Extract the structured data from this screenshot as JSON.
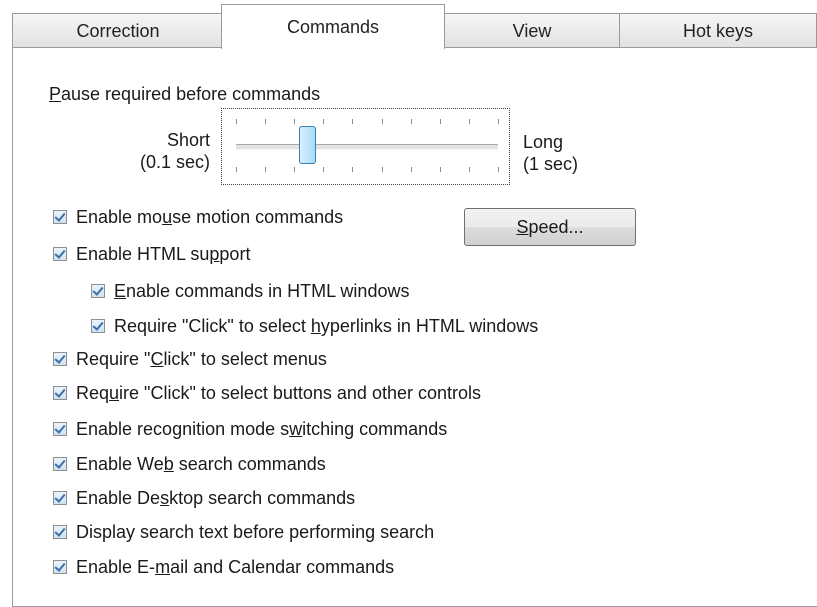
{
  "tabs": [
    {
      "id": "correction",
      "label": "Correction"
    },
    {
      "id": "commands",
      "label": "Commands"
    },
    {
      "id": "view",
      "label": "View"
    },
    {
      "id": "hotkeys",
      "label": "Hot keys"
    }
  ],
  "active_tab": "commands",
  "pause": {
    "label_ul": "P",
    "label_rest": "ause required before commands",
    "short_line1": "Short",
    "short_line2": "(0.1 sec)",
    "long_line1": "Long",
    "long_line2": "(1 sec)",
    "value_fraction": 0.2
  },
  "speed_button": {
    "label_ul": "S",
    "label_rest": "peed..."
  },
  "options": [
    {
      "pre": "Enable mo",
      "ul": "u",
      "post": "se motion commands",
      "checked": true
    },
    {
      "pre": "Enable HTML su",
      "ul": "p",
      "post": "port",
      "checked": true
    },
    {
      "pre": "",
      "ul": "E",
      "post": "nable commands in HTML windows",
      "checked": true
    },
    {
      "pre": "Require \"Click\" to select ",
      "ul": "h",
      "post": "yperlinks in HTML windows",
      "checked": true
    },
    {
      "pre": "Require \"",
      "ul": "C",
      "post": "lick\" to select menus",
      "checked": true
    },
    {
      "pre": "Req",
      "ul": "u",
      "post": "ire \"Click\" to select buttons and other controls",
      "checked": true
    },
    {
      "pre": "Enable recognition mode s",
      "ul": "w",
      "post": "itching commands",
      "checked": true
    },
    {
      "pre": "Enable We",
      "ul": "b",
      "post": " search commands",
      "checked": true
    },
    {
      "pre": "Enable De",
      "ul": "s",
      "post": "ktop search commands",
      "checked": true
    },
    {
      "pre": "Display search text before performing search",
      "ul": "",
      "post": "",
      "checked": true
    },
    {
      "pre": "Enable E-",
      "ul": "m",
      "post": "ail and Calendar commands",
      "checked": true
    }
  ]
}
